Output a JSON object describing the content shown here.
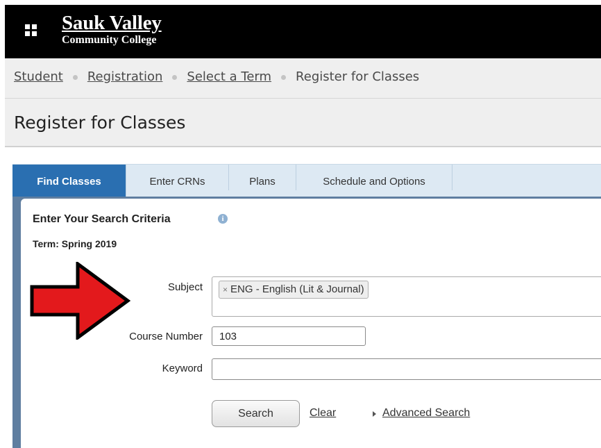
{
  "header": {
    "logo_main": "Sauk Valley",
    "logo_sub": "Community College",
    "menu_icon": "grid-icon"
  },
  "breadcrumb": {
    "items": [
      "Student",
      "Registration",
      "Select a Term",
      "Register for Classes"
    ]
  },
  "page_title": "Register for Classes",
  "tabs": [
    {
      "label": "Find Classes",
      "active": true
    },
    {
      "label": "Enter CRNs",
      "active": false
    },
    {
      "label": "Plans",
      "active": false
    },
    {
      "label": "Schedule and Options",
      "active": false
    }
  ],
  "search": {
    "heading": "Enter Your Search Criteria",
    "info_icon": "info-icon",
    "term": "Term: Spring 2019",
    "subject_label": "Subject",
    "subject_selected": "ENG - English (Lit & Journal)",
    "remove_icon": "×",
    "course_number_label": "Course Number",
    "course_number_value": "103",
    "keyword_label": "Keyword",
    "keyword_value": "",
    "search_button": "Search",
    "clear_link": "Clear",
    "advanced_link": "Advanced Search"
  },
  "colors": {
    "header_bg": "#000000",
    "tab_active": "#2a6fb1",
    "tab_strip": "#dde9f3",
    "panel_border": "#5f7ea0",
    "annotation_arrow": "#e3191c"
  }
}
